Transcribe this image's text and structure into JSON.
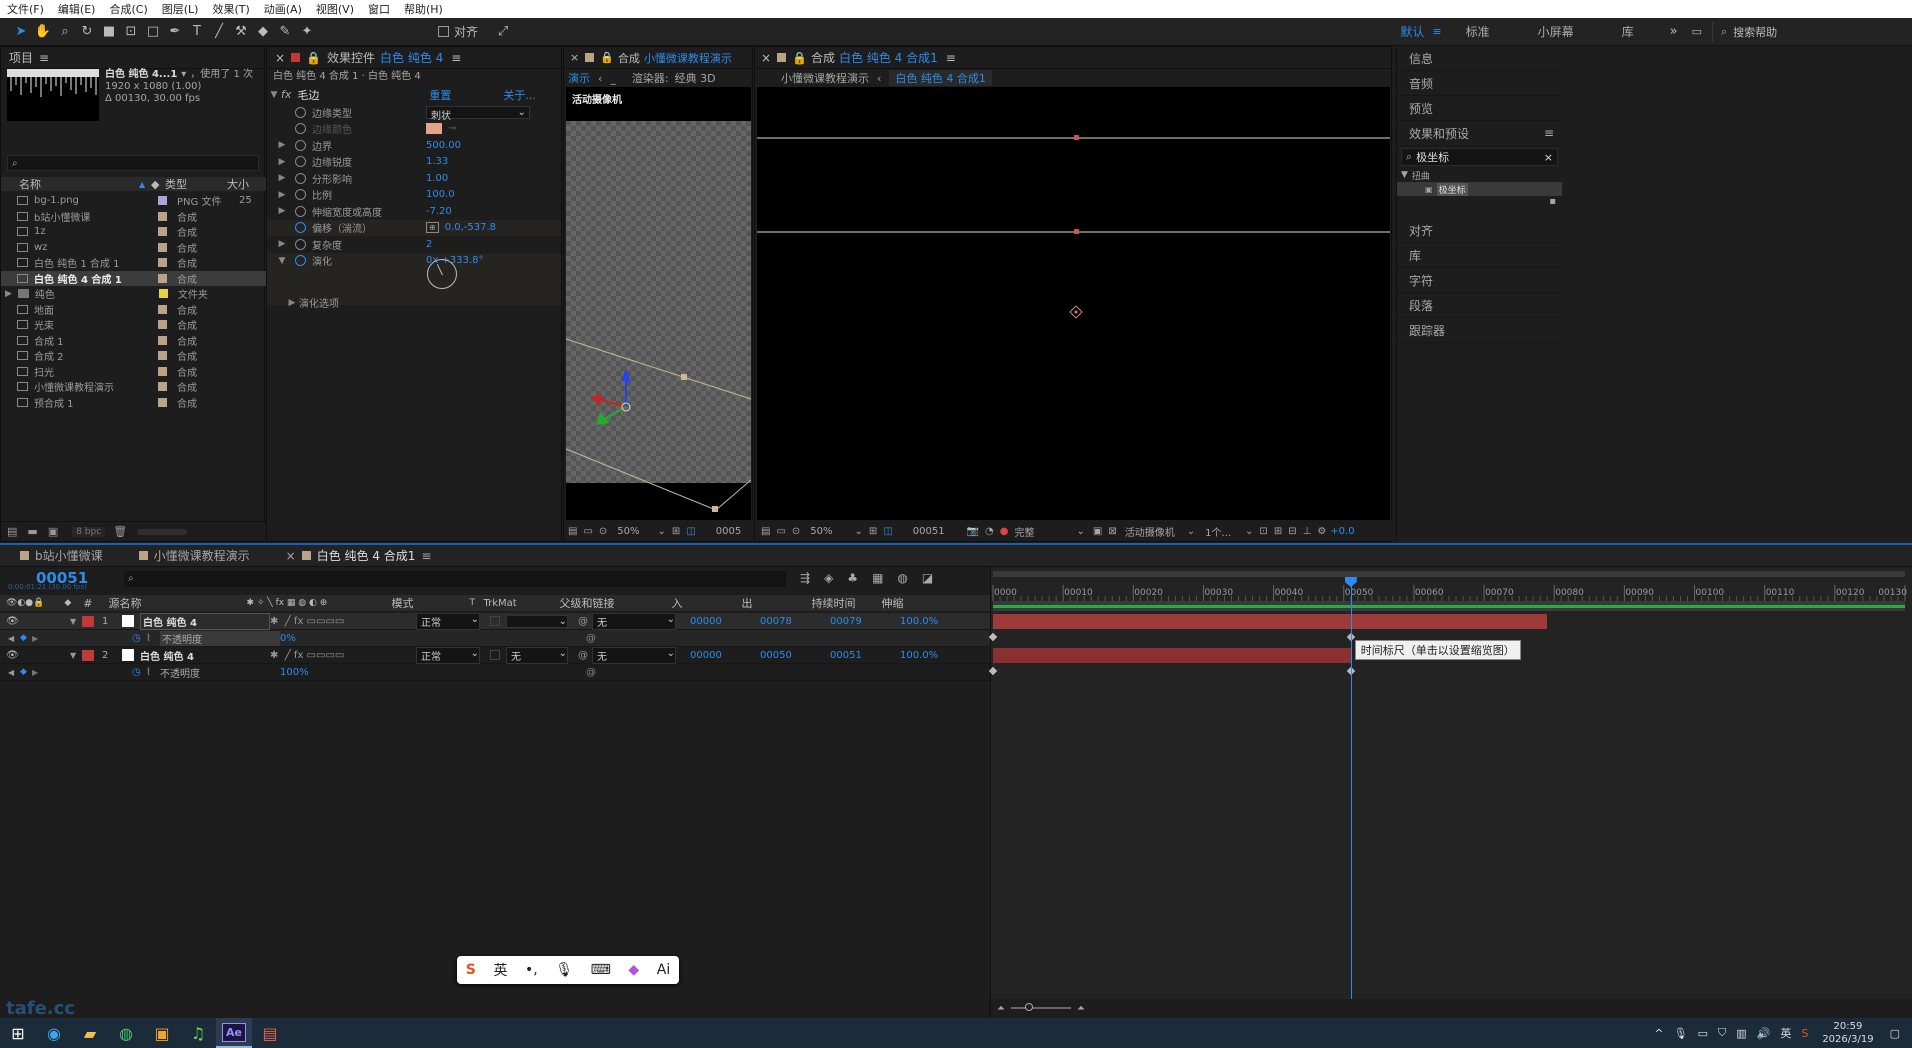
{
  "menu": [
    "文件(F)",
    "编辑(E)",
    "合成(C)",
    "图层(L)",
    "效果(T)",
    "动画(A)",
    "视图(V)",
    "窗口",
    "帮助(H)"
  ],
  "toolbar": {
    "align_label": "对齐",
    "workspaces": [
      "默认",
      "标准",
      "小屏幕",
      "库"
    ],
    "search_placeholder": "搜索帮助"
  },
  "project": {
    "tab": "项目",
    "comp_name": "白色 纯色 4...1",
    "used": "，使用了 1 次",
    "dims": "1920 x 1080 (1.00)",
    "duration": "Δ 00130, 30.00 fps",
    "headers": {
      "name": "名称",
      "type": "类型",
      "size": "大小"
    },
    "items": [
      {
        "name": "bg-1.png",
        "type": "PNG 文件",
        "size": "25",
        "color": "#a9a6d9",
        "icon": "image-icon"
      },
      {
        "name": "b站小懂微课",
        "type": "合成",
        "size": "",
        "color": "#b9a487",
        "icon": "comp-icon"
      },
      {
        "name": "1z",
        "type": "合成",
        "size": "",
        "color": "#b9a487",
        "icon": "comp-icon"
      },
      {
        "name": "wz",
        "type": "合成",
        "size": "",
        "color": "#b9a487",
        "icon": "comp-icon"
      },
      {
        "name": "白色 纯色 1 合成 1",
        "type": "合成",
        "size": "",
        "color": "#b9a487",
        "icon": "comp-icon"
      },
      {
        "name": "白色 纯色 4 合成 1",
        "type": "合成",
        "size": "",
        "color": "#b9a487",
        "icon": "comp-icon",
        "selected": true
      },
      {
        "name": "纯色",
        "type": "文件夹",
        "size": "",
        "color": "#e6d23c",
        "icon": "folder-icon"
      },
      {
        "name": "地面",
        "type": "合成",
        "size": "",
        "color": "#b9a487",
        "icon": "comp-icon"
      },
      {
        "name": "光束",
        "type": "合成",
        "size": "",
        "color": "#b9a487",
        "icon": "comp-icon"
      },
      {
        "name": "合成 1",
        "type": "合成",
        "size": "",
        "color": "#b9a487",
        "icon": "comp-icon"
      },
      {
        "name": "合成 2",
        "type": "合成",
        "size": "",
        "color": "#b9a487",
        "icon": "comp-icon"
      },
      {
        "name": "扫光",
        "type": "合成",
        "size": "",
        "color": "#b9a487",
        "icon": "comp-icon"
      },
      {
        "name": "小懂微课教程演示",
        "type": "合成",
        "size": "",
        "color": "#b9a487",
        "icon": "comp-icon"
      },
      {
        "name": "预合成 1",
        "type": "合成",
        "size": "",
        "color": "#b9a487",
        "icon": "comp-icon"
      }
    ],
    "bpc": "8 bpc"
  },
  "effects": {
    "tab_prefix": "效果控件",
    "tab_layer": "白色 纯色 4",
    "breadcrumb": "白色 纯色 4 合成 1 · 白色 纯色 4",
    "effect_name": "毛边",
    "reset": "重置",
    "about": "关于...",
    "props": [
      {
        "name": "边缘类型",
        "value": "刺状",
        "kind": "select"
      },
      {
        "name": "边缘颜色",
        "value": "",
        "kind": "color"
      },
      {
        "name": "边界",
        "value": "500.00"
      },
      {
        "name": "边缘锐度",
        "value": "1.33"
      },
      {
        "name": "分形影响",
        "value": "1.00"
      },
      {
        "name": "比例",
        "value": "100.0"
      },
      {
        "name": "伸缩宽度或高度",
        "value": "-7.20"
      },
      {
        "name": "偏移（湍流）",
        "value": "0.0,-537.8",
        "kind": "point"
      },
      {
        "name": "复杂度",
        "value": "2"
      },
      {
        "name": "演化",
        "value": "0x +333.8°",
        "kind": "angle"
      }
    ],
    "evo_options": "演化选项"
  },
  "comp_left": {
    "tab": "合成",
    "tab_name": "小懂微课教程演示",
    "sub": "演示",
    "renderer_label": "渲染器:",
    "renderer": "经典 3D",
    "camera": "活动摄像机",
    "zoom": "50%",
    "frame": "0005"
  },
  "comp_right": {
    "tab": "合成",
    "tab_name": "白色 纯色 4 合成1",
    "crumb1": "小懂微课教程演示",
    "crumb2": "白色 纯色 4 合成1",
    "zoom": "50%",
    "frame": "00051",
    "quality": "完整",
    "camera": "活动摄像机",
    "views": "1个...",
    "exposure": "+0.0"
  },
  "right_panel": {
    "items_top": [
      "信息",
      "音频",
      "预览"
    ],
    "effects_title": "效果和预设",
    "search_value": "极坐标",
    "category": "扭曲",
    "result": "极坐标",
    "items_bottom": [
      "对齐",
      "库",
      "字符",
      "段落",
      "跟踪器"
    ]
  },
  "timeline": {
    "tabs": [
      "b站小懂微课",
      "小懂微课教程演示",
      "白色 纯色 4 合成1"
    ],
    "timecode": "00051",
    "timecode_sub": "0:00:01:21 (30.00 fps)",
    "headers": {
      "source": "源名称",
      "mode": "模式",
      "t": "T",
      "trkmat": "TrkMat",
      "parent": "父级和链接",
      "in": "入",
      "out": "出",
      "duration": "持续时间",
      "stretch": "伸缩"
    },
    "ruler": [
      "0000",
      "00010",
      "00020",
      "00030",
      "00040",
      "00050",
      "00060",
      "00070",
      "00080",
      "00090",
      "00100",
      "00110",
      "00120",
      "00130"
    ],
    "layers": [
      {
        "num": "1",
        "name": "白色 纯色 4",
        "mode": "正常",
        "trkmat": "",
        "parent": "无",
        "in": "00000",
        "out": "00078",
        "dur": "00079",
        "stretch": "100.0%",
        "prop": "不透明度",
        "prop_val": "0%",
        "bar_end": 79
      },
      {
        "num": "2",
        "name": "白色 纯色 4",
        "mode": "正常",
        "trkmat": "无",
        "parent": "无",
        "in": "00000",
        "out": "00050",
        "dur": "00051",
        "stretch": "100.0%",
        "prop": "不透明度",
        "prop_val": "100%",
        "bar_end": 51
      }
    ],
    "tooltip": "时间标尺（单击以设置缩览图）",
    "current_frame": 51,
    "total_frames": 130
  },
  "ime": {
    "lang": "英",
    "ai": "Ai"
  },
  "taskbar": {
    "time": "20:59",
    "date": "2026/3/19",
    "ime": "英"
  },
  "watermark": "tafe.cc"
}
